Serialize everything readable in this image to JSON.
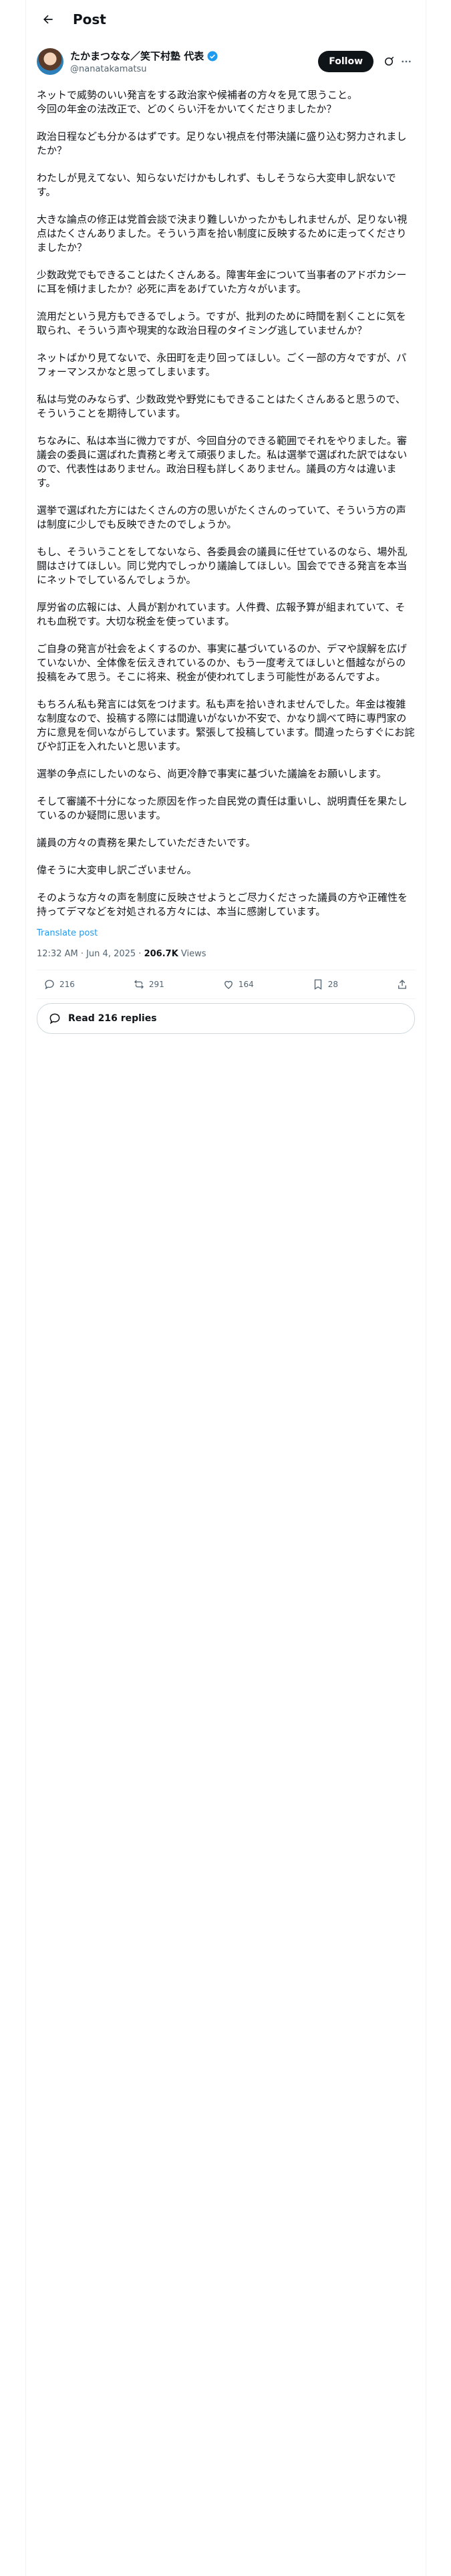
{
  "header": {
    "title": "Post"
  },
  "author": {
    "display_name": "たかまつなな／笑下村塾 代表",
    "handle": "@nanatakamatsu"
  },
  "follow_label": "Follow",
  "paragraphs": [
    "ネットで威勢のいい発言をする政治家や候補者の方々を見て思うこと。\n今回の年金の法改正で、どのくらい汗をかいてくださりましたか？",
    "政治日程なども分かるはずです。足りない視点を付帯決議に盛り込む努力されましたか？",
    "わたしが見えてない、知らないだけかもしれず、もしそうなら大変申し訳ないです。",
    "大きな論点の修正は党首会談で決まり難しいかったかもしれませんが、足りない視点はたくさんありました。そういう声を拾い制度に反映するために走ってくださりましたか？",
    "少数政党でもできることはたくさんある。障害年金について当事者のアドボカシーに耳を傾けましたか？必死に声をあげていた方々がいます。",
    "流用だという見方もできるでしょう。ですが、批判のために時間を割くことに気を取られ、そういう声や現実的な政治日程のタイミング逃していませんか？",
    "ネットばかり見てないで、永田町を走り回ってほしい。ごく一部の方々ですが、パフォーマンスかなと思ってしまいます。",
    "私は与党のみならず、少数政党や野党にもできることはたくさんあると思うので、そういうことを期待しています。",
    "ちなみに、私は本当に微力ですが、今回自分のできる範囲でそれをやりました。審議会の委員に選ばれた責務と考えて頑張りました。私は選挙で選ばれた訳ではないので、代表性はありません。政治日程も詳しくありません。議員の方々は違います。",
    "選挙で選ばれた方にはたくさんの方の思いがたくさんのっていて、そういう方の声は制度に少しでも反映できたのでしょうか。",
    "もし、そういうことをしてないなら、各委員会の議員に任せているのなら、場外乱闘はさけてほしい。同じ党内でしっかり議論してほしい。国会でできる発言を本当にネットでしているんでしょうか。",
    "厚労省の広報には、人員が割かれています。人件費、広報予算が組まれていて、それも血税です。大切な税金を使っています。",
    "ご自身の発言が社会をよくするのか、事実に基づいているのか、デマや誤解を広げていないか、全体像を伝えきれているのか、もう一度考えてほしいと僭越ながらの投稿をみて思う。そこに将来、税金が使われてしまう可能性があるんですよ。",
    "もちろん私も発言には気をつけます。私も声を拾いきれませんでした。年金は複雑な制度なので、投稿する際には間違いがないか不安で、かなり調べて時に専門家の方に意見を伺いながらしています。緊張して投稿しています。間違ったらすぐにお詫びや訂正を入れたいと思います。",
    "選挙の争点にしたいのなら、尚更冷静で事実に基づいた議論をお願いします。",
    "そして審議不十分になった原因を作った自民党の責任は重いし、説明責任を果たしているのか疑問に思います。",
    "議員の方々の責務を果たしていただきたいです。",
    "偉そうに大変申し訳ございません。",
    "そのような方々の声を制度に反映させようとご尽力くださった議員の方や正確性を持ってデマなどを対処される方々には、本当に感謝しています。"
  ],
  "translate_label": "Translate post",
  "meta": {
    "time": "12:32 AM · Jun 4, 2025 · ",
    "views_count": "206.7K",
    "views_label": " Views"
  },
  "actions": {
    "replies": "216",
    "reposts": "291",
    "likes": "164",
    "bookmarks": "28"
  },
  "read_replies_label": "Read 216 replies",
  "colors": {
    "accent": "#1d9bf0",
    "text": "#0f1419",
    "muted": "#536471",
    "border": "#eff3f4"
  }
}
